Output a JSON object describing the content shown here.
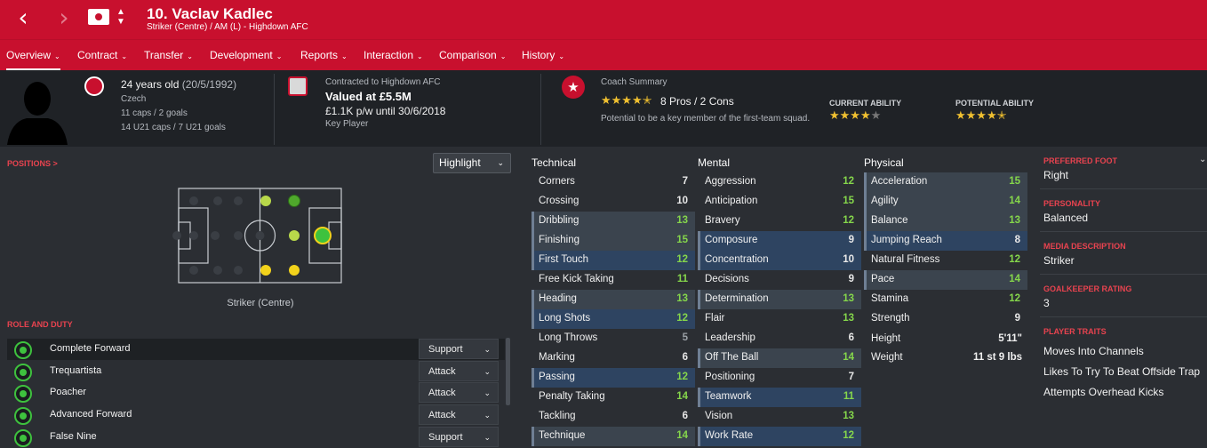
{
  "header": {
    "player_name": "10. Vaclav Kadlec",
    "subtitle": "Striker (Centre) / AM (L) - Highdown AFC"
  },
  "tabs": [
    {
      "label": "Overview"
    },
    {
      "label": "Contract"
    },
    {
      "label": "Transfer"
    },
    {
      "label": "Development"
    },
    {
      "label": "Reports"
    },
    {
      "label": "Interaction"
    },
    {
      "label": "Comparison"
    },
    {
      "label": "History"
    }
  ],
  "profile": {
    "age": "24 years old",
    "dob": "(20/5/1992)",
    "nationality": "Czech",
    "caps": "11 caps / 2 goals",
    "u21_caps": "14 U21 caps / 7 U21 goals"
  },
  "contract": {
    "club_line": "Contracted to Highdown AFC",
    "value": "Valued at £5.5M",
    "wage": "£1.1K p/w until 30/6/2018",
    "status": "Key Player"
  },
  "coach": {
    "title": "Coach Summary",
    "rating_stars": 4.5,
    "pros_cons": "8 Pros / 2 Cons",
    "summary": "Potential to be a key member of the first-team squad.",
    "current_ability_label": "CURRENT ABILITY",
    "current_ability_stars": 4,
    "potential_ability_label": "POTENTIAL ABILITY",
    "potential_ability_stars": 4.5
  },
  "positions": {
    "title": "POSITIONS >",
    "highlight_label": "Highlight",
    "position_label": "Striker (Centre)"
  },
  "roles": {
    "title": "ROLE AND DUTY",
    "items": [
      {
        "name": "Complete Forward",
        "duty": "Support"
      },
      {
        "name": "Trequartista",
        "duty": "Attack"
      },
      {
        "name": "Poacher",
        "duty": "Attack"
      },
      {
        "name": "Advanced Forward",
        "duty": "Attack"
      },
      {
        "name": "False Nine",
        "duty": "Support"
      }
    ]
  },
  "attributes": {
    "technical_label": "Technical",
    "mental_label": "Mental",
    "physical_label": "Physical",
    "technical": [
      {
        "name": "Corners",
        "value": "7"
      },
      {
        "name": "Crossing",
        "value": "10"
      },
      {
        "name": "Dribbling",
        "value": "13"
      },
      {
        "name": "Finishing",
        "value": "15"
      },
      {
        "name": "First Touch",
        "value": "12"
      },
      {
        "name": "Free Kick Taking",
        "value": "11"
      },
      {
        "name": "Heading",
        "value": "13"
      },
      {
        "name": "Long Shots",
        "value": "12"
      },
      {
        "name": "Long Throws",
        "value": "5"
      },
      {
        "name": "Marking",
        "value": "6"
      },
      {
        "name": "Passing",
        "value": "12"
      },
      {
        "name": "Penalty Taking",
        "value": "14"
      },
      {
        "name": "Tackling",
        "value": "6"
      },
      {
        "name": "Technique",
        "value": "14"
      }
    ],
    "mental": [
      {
        "name": "Aggression",
        "value": "12"
      },
      {
        "name": "Anticipation",
        "value": "15"
      },
      {
        "name": "Bravery",
        "value": "12"
      },
      {
        "name": "Composure",
        "value": "9"
      },
      {
        "name": "Concentration",
        "value": "10"
      },
      {
        "name": "Decisions",
        "value": "9"
      },
      {
        "name": "Determination",
        "value": "13"
      },
      {
        "name": "Flair",
        "value": "13"
      },
      {
        "name": "Leadership",
        "value": "6"
      },
      {
        "name": "Off The Ball",
        "value": "14"
      },
      {
        "name": "Positioning",
        "value": "7"
      },
      {
        "name": "Teamwork",
        "value": "11"
      },
      {
        "name": "Vision",
        "value": "13"
      },
      {
        "name": "Work Rate",
        "value": "12"
      }
    ],
    "physical": [
      {
        "name": "Acceleration",
        "value": "15"
      },
      {
        "name": "Agility",
        "value": "14"
      },
      {
        "name": "Balance",
        "value": "13"
      },
      {
        "name": "Jumping Reach",
        "value": "8"
      },
      {
        "name": "Natural Fitness",
        "value": "12"
      },
      {
        "name": "Pace",
        "value": "14"
      },
      {
        "name": "Stamina",
        "value": "12"
      },
      {
        "name": "Strength",
        "value": "9"
      }
    ],
    "height_label": "Height",
    "height_value": "5'11\"",
    "weight_label": "Weight",
    "weight_value": "11 st 9 lbs"
  },
  "side": {
    "preferred_foot_label": "PREFERRED FOOT",
    "preferred_foot": "Right",
    "personality_label": "PERSONALITY",
    "personality": "Balanced",
    "media_label": "MEDIA DESCRIPTION",
    "media": "Striker",
    "gk_label": "GOALKEEPER RATING",
    "gk": "3",
    "traits_label": "PLAYER TRAITS",
    "traits": [
      "Moves Into Channels",
      "Likes To Try To Beat Offside Trap",
      "Attempts Overhead Kicks"
    ]
  },
  "colors": {
    "brand_red": "#c8102e",
    "attr_good": "#85d64b",
    "role_green": "#3ec23e"
  }
}
